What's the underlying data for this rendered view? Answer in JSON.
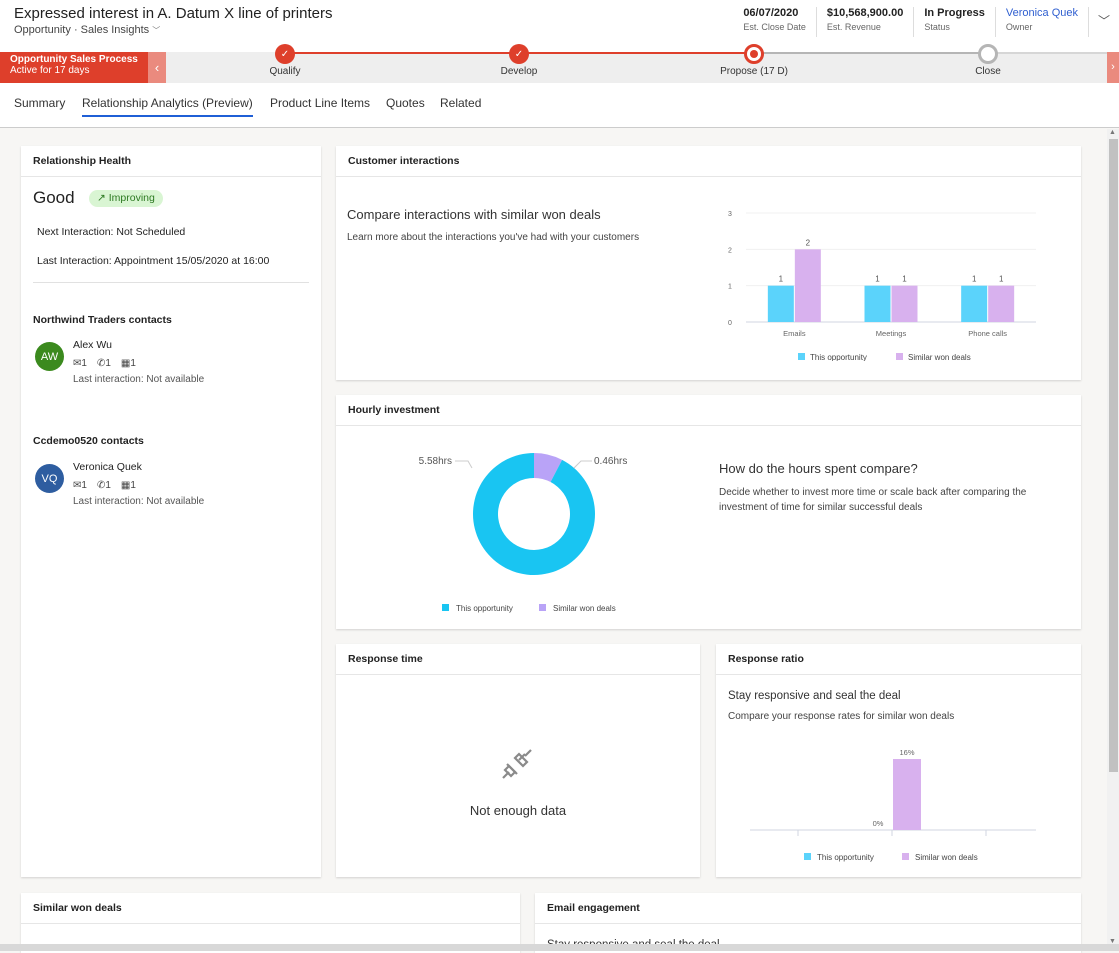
{
  "header": {
    "title": "Expressed interest in A. Datum X line of printers",
    "entity": "Opportunity",
    "separator": "·",
    "form": "Sales Insights",
    "fields": [
      {
        "value": "06/07/2020",
        "label": "Est. Close Date"
      },
      {
        "value": "$10,568,900.00",
        "label": "Est. Revenue"
      },
      {
        "value": "In Progress",
        "label": "Status"
      },
      {
        "value": "Veronica Quek",
        "label": "Owner"
      }
    ]
  },
  "bpf": {
    "name": "Opportunity Sales Process",
    "active": "Active for 17 days",
    "stages": [
      {
        "label": "Qualify",
        "state": "completed"
      },
      {
        "label": "Develop",
        "state": "completed"
      },
      {
        "label": "Propose  (17 D)",
        "state": "active"
      },
      {
        "label": "Close",
        "state": "pending"
      }
    ]
  },
  "tabs": [
    {
      "label": "Summary",
      "active": false
    },
    {
      "label": "Relationship Analytics (Preview)",
      "active": true
    },
    {
      "label": "Product Line Items",
      "active": false
    },
    {
      "label": "Quotes",
      "active": false
    },
    {
      "label": "Related",
      "active": false
    }
  ],
  "health": {
    "title": "Relationship Health",
    "status": "Good",
    "trend": "Improving",
    "next": "Next Interaction: Not Scheduled",
    "last": "Last Interaction: Appointment 15/05/2020 at 16:00",
    "groups": [
      {
        "title": "Northwind Traders contacts",
        "contacts": [
          {
            "initials": "AW",
            "name": "Alex Wu",
            "color": "#3b8a1e",
            "emails": "1",
            "calls": "1",
            "meetings": "1",
            "last": "Last interaction: Not available"
          }
        ]
      },
      {
        "title": "Ccdemo0520 contacts",
        "contacts": [
          {
            "initials": "VQ",
            "name": "Veronica Quek",
            "color": "#2e5da0",
            "emails": "1",
            "calls": "1",
            "meetings": "1",
            "last": "Last interaction: Not available"
          }
        ]
      }
    ]
  },
  "interactions": {
    "title": "Customer interactions",
    "heading": "Compare interactions with similar won deals",
    "desc": "Learn more about the interactions you've had with your customers"
  },
  "hourly": {
    "title": "Hourly investment",
    "heading": "How do the hours spent compare?",
    "desc": "Decide whether to invest more time or scale back after comparing the investment of time for similar successful deals"
  },
  "response_time": {
    "title": "Response time",
    "empty": "Not enough data"
  },
  "response_ratio": {
    "title": "Response ratio",
    "heading": "Stay responsive and seal the deal",
    "desc": "Compare your response rates for similar won deals"
  },
  "similar": {
    "title": "Similar won deals"
  },
  "email": {
    "title": "Email engagement",
    "heading": "Stay responsive and seal the deal"
  },
  "colors": {
    "this": "#5bd3fb",
    "similar": "#d8b1ee",
    "donut_this": "#19c5f2",
    "donut_similar": "#b9a3f7",
    "accent": "#de3f2b"
  },
  "chart_data": [
    {
      "type": "bar",
      "title": "Compare interactions with similar won deals",
      "categories": [
        "Emails",
        "Meetings",
        "Phone calls"
      ],
      "series": [
        {
          "name": "This opportunity",
          "values": [
            1,
            1,
            1
          ]
        },
        {
          "name": "Similar won deals",
          "values": [
            2,
            1,
            1
          ]
        }
      ],
      "yticks": [
        "0",
        "1",
        "2",
        "3"
      ],
      "ylim": [
        0,
        3
      ],
      "grid": true,
      "legend": "bottom"
    },
    {
      "type": "pie",
      "title": "Hourly investment",
      "labels": [
        "This opportunity",
        "Similar won deals"
      ],
      "values": [
        5.58,
        0.46
      ],
      "value_labels": [
        "5.58hrs",
        "0.46hrs"
      ],
      "legend": "bottom"
    },
    {
      "type": "bar",
      "title": "Response ratio",
      "categories": [
        "This opportunity",
        "Similar won deals"
      ],
      "values": [
        0,
        16
      ],
      "value_labels": [
        "0%",
        "16%"
      ],
      "unit": "%",
      "legend": "bottom"
    }
  ]
}
